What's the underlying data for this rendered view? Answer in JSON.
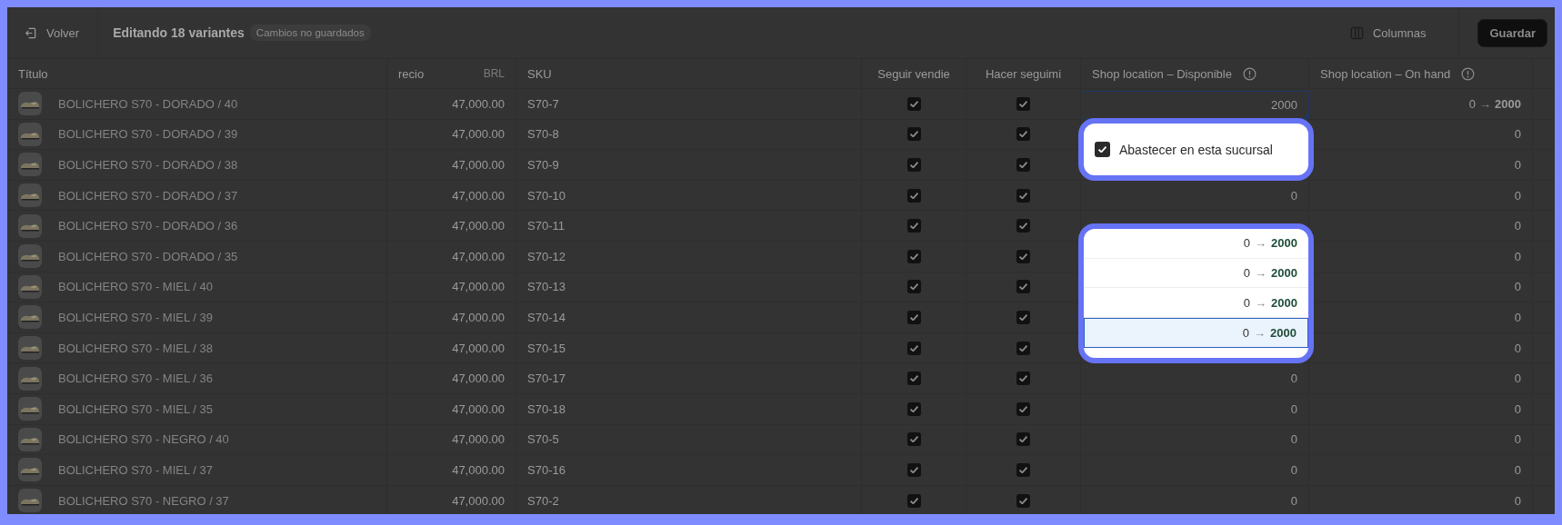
{
  "toolbar": {
    "back": "Volver",
    "title": "Editando 18 variantes",
    "badge": "Cambios no guardados",
    "columns": "Columnas",
    "save": "Guardar"
  },
  "table": {
    "columns": [
      {
        "label": "Título"
      },
      {
        "label": "recio",
        "unit": "BRL"
      },
      {
        "label": "SKU"
      },
      {
        "label": "Seguir vendie"
      },
      {
        "label": "Hacer seguimi"
      },
      {
        "label": "Shop location – Disponible",
        "info": true
      },
      {
        "label": "Shop location – On hand",
        "info": true
      }
    ],
    "rows": [
      {
        "title": "BOLICHERO S70 - DORADO / 40",
        "price": "47,000.00",
        "sku": "S70-7",
        "continue_selling": true,
        "track": true,
        "available_input": "2000",
        "on_hand": {
          "from": "0",
          "arrow": "→",
          "to": "2000"
        }
      },
      {
        "title": "BOLICHERO S70 - DORADO / 39",
        "price": "47,000.00",
        "sku": "S70-8",
        "continue_selling": true,
        "track": true,
        "on_hand": {
          "from": "0"
        }
      },
      {
        "title": "BOLICHERO S70 - DORADO / 38",
        "price": "47,000.00",
        "sku": "S70-9",
        "continue_selling": true,
        "track": true,
        "on_hand": {
          "from": "0"
        }
      },
      {
        "title": "BOLICHERO S70 - DORADO / 37",
        "price": "47,000.00",
        "sku": "S70-10",
        "continue_selling": true,
        "track": true,
        "available": "0",
        "on_hand": {
          "from": "0"
        }
      },
      {
        "title": "BOLICHERO S70 - DORADO / 36",
        "price": "47,000.00",
        "sku": "S70-11",
        "continue_selling": true,
        "track": true,
        "on_hand": {
          "from": "0"
        }
      },
      {
        "title": "BOLICHERO S70 - DORADO / 35",
        "price": "47,000.00",
        "sku": "S70-12",
        "continue_selling": true,
        "track": true,
        "on_hand": {
          "from": "0"
        }
      },
      {
        "title": "BOLICHERO S70 - MIEL / 40",
        "price": "47,000.00",
        "sku": "S70-13",
        "continue_selling": true,
        "track": true,
        "on_hand": {
          "from": "0"
        }
      },
      {
        "title": "BOLICHERO S70 - MIEL / 39",
        "price": "47,000.00",
        "sku": "S70-14",
        "continue_selling": true,
        "track": true,
        "on_hand": {
          "from": "0"
        }
      },
      {
        "title": "BOLICHERO S70 - MIEL / 38",
        "price": "47,000.00",
        "sku": "S70-15",
        "continue_selling": true,
        "track": true,
        "on_hand": {
          "from": "0"
        }
      },
      {
        "title": "BOLICHERO S70 - MIEL / 36",
        "price": "47,000.00",
        "sku": "S70-17",
        "continue_selling": true,
        "track": true,
        "available": "0",
        "on_hand": {
          "from": "0"
        }
      },
      {
        "title": "BOLICHERO S70 - MIEL / 35",
        "price": "47,000.00",
        "sku": "S70-18",
        "continue_selling": true,
        "track": true,
        "available": "0",
        "on_hand": {
          "from": "0"
        }
      },
      {
        "title": "BOLICHERO S70 - NEGRO / 40",
        "price": "47,000.00",
        "sku": "S70-5",
        "continue_selling": true,
        "track": true,
        "available": "0",
        "on_hand": {
          "from": "0"
        }
      },
      {
        "title": "BOLICHERO S70 - MIEL / 37",
        "price": "47,000.00",
        "sku": "S70-16",
        "continue_selling": true,
        "track": true,
        "available": "0",
        "on_hand": {
          "from": "0"
        }
      },
      {
        "title": "BOLICHERO S70 - NEGRO / 37",
        "price": "47,000.00",
        "sku": "S70-2",
        "continue_selling": true,
        "track": true,
        "available": "0",
        "on_hand": {
          "from": "0"
        }
      }
    ]
  },
  "stock_toggle": {
    "label": "Abastecer en esta sucursal",
    "checked": true
  },
  "pending_changes": [
    {
      "from": "0",
      "arrow": "→",
      "to": "2000",
      "selected": false
    },
    {
      "from": "0",
      "arrow": "→",
      "to": "2000",
      "selected": false
    },
    {
      "from": "0",
      "arrow": "→",
      "to": "2000",
      "selected": false
    },
    {
      "from": "0",
      "arrow": "→",
      "to": "2000",
      "selected": true
    }
  ]
}
